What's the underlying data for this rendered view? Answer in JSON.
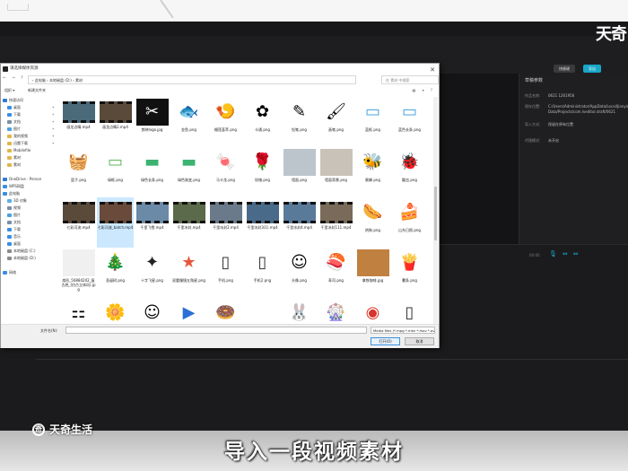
{
  "editor": {
    "brand_top": "天奇",
    "btn_shortcut": "快捷键",
    "btn_export": "导出",
    "panel_title": "草稿参数",
    "props": [
      {
        "k": "作品名称:",
        "v": "0621 1261956"
      },
      {
        "k": "保存位置:",
        "v": "C:/Users/Administrator/AppData/Local/JianyingPro/User Data/Projects/com.lveditor.draft/0621"
      },
      {
        "k": "导入方式:",
        "v": "保留在原有位置"
      },
      {
        "k": "color_space",
        "v": ""
      },
      {
        "k": "代理模式:",
        "v": "未开启"
      }
    ],
    "ruler": "00:00"
  },
  "dialog": {
    "title": "请选择媒体资源",
    "close": "✕",
    "nav_arrows": "← → ↑",
    "path": "› 此电脑 › 本地磁盘 (D:) › 素材",
    "search_placeholder": "在 素材 中搜索",
    "organize": "组织 ▾",
    "new_folder": "新建文件夹",
    "view_icons": "▦ ▾ ?",
    "nav_items": [
      {
        "label": "快速访问",
        "color": "#2e7bd6",
        "indent": false,
        "pin": false
      },
      {
        "label": "桌面",
        "color": "#3a8ee6",
        "indent": true,
        "pin": true
      },
      {
        "label": "下载",
        "color": "#3a8ee6",
        "indent": true,
        "pin": true
      },
      {
        "label": "文档",
        "color": "#7a8ea6",
        "indent": true,
        "pin": true
      },
      {
        "label": "图片",
        "color": "#4aa3df",
        "indent": true,
        "pin": true
      },
      {
        "label": "我的视频",
        "color": "#e0b64a",
        "indent": true,
        "pin": true
      },
      {
        "label": "迅雷下载",
        "color": "#e0b64a",
        "indent": true,
        "pin": true
      },
      {
        "label": "Mobilefile",
        "color": "#e0b64a",
        "indent": true,
        "pin": false
      },
      {
        "label": "素材",
        "color": "#e0b64a",
        "indent": true,
        "pin": false
      },
      {
        "label": "素材",
        "color": "#e0b64a",
        "indent": true,
        "pin": false
      },
      {
        "label": "",
        "color": "transparent",
        "indent": false,
        "pin": false
      },
      {
        "label": "OneDrive - Person",
        "color": "#2e7bd6",
        "indent": false,
        "pin": false
      },
      {
        "label": "WPS网盘",
        "color": "#3a8ee6",
        "indent": false,
        "pin": false
      },
      {
        "label": "此电脑",
        "color": "#3a8ee6",
        "indent": false,
        "pin": false
      },
      {
        "label": "3D 对象",
        "color": "#5ab0e6",
        "indent": true,
        "pin": false
      },
      {
        "label": "视频",
        "color": "#7a8ea6",
        "indent": true,
        "pin": false
      },
      {
        "label": "图片",
        "color": "#4aa3df",
        "indent": true,
        "pin": false
      },
      {
        "label": "文档",
        "color": "#7a8ea6",
        "indent": true,
        "pin": false
      },
      {
        "label": "下载",
        "color": "#3a8ee6",
        "indent": true,
        "pin": false
      },
      {
        "label": "音乐",
        "color": "#3a8ee6",
        "indent": true,
        "pin": false
      },
      {
        "label": "桌面",
        "color": "#3a8ee6",
        "indent": true,
        "pin": false
      },
      {
        "label": "本地磁盘 (C:)",
        "color": "#8a8a8a",
        "indent": true,
        "pin": false
      },
      {
        "label": "本地磁盘 (D:)",
        "color": "#8a8a8a",
        "indent": true,
        "pin": false
      },
      {
        "label": "",
        "color": "transparent",
        "indent": false,
        "pin": false
      },
      {
        "label": "网络",
        "color": "#3a8ee6",
        "indent": false,
        "pin": false
      }
    ],
    "files": [
      {
        "name": "画龙点睛.mp4",
        "kind": "video",
        "bg": "#4a6a7a",
        "glyph": ""
      },
      {
        "name": "画龙点睛2.mp4",
        "kind": "video",
        "bg": "#5a4a3a",
        "glyph": ""
      },
      {
        "name": "剪映logo.jpg",
        "kind": "img",
        "bg": "#111111",
        "glyph": "✂"
      },
      {
        "name": "金鱼.png",
        "kind": "img",
        "bg": "#ffffff",
        "glyph": "🐟"
      },
      {
        "name": "榴莲荟萃.png",
        "kind": "img",
        "bg": "#ffffff",
        "glyph": "🍤"
      },
      {
        "name": "卡通.png",
        "kind": "img",
        "bg": "#ffffff",
        "glyph": "✿"
      },
      {
        "name": "铅笔.png",
        "kind": "img",
        "bg": "#ffffff",
        "glyph": "✎"
      },
      {
        "name": "画笔.png",
        "kind": "img",
        "bg": "#ffffff",
        "glyph": "🖌"
      },
      {
        "name": "蓝框.png",
        "kind": "img",
        "bg": "#ffffff",
        "glyph": "▭"
      },
      {
        "name": "蓝色长条.png",
        "kind": "img",
        "bg": "#ffffff",
        "glyph": "▭"
      },
      {
        "name": "篮子.png",
        "kind": "img",
        "bg": "#ffffff",
        "glyph": "🧺"
      },
      {
        "name": "绿框.png",
        "kind": "img",
        "bg": "#ffffff",
        "glyph": "▭"
      },
      {
        "name": "绿色长条.png",
        "kind": "img",
        "bg": "#ffffff",
        "glyph": "▬"
      },
      {
        "name": "绿色渐变.png",
        "kind": "img",
        "bg": "#ffffff",
        "glyph": "▬"
      },
      {
        "name": "马卡龙.png",
        "kind": "img",
        "bg": "#ffffff",
        "glyph": "🍬"
      },
      {
        "name": "玫瑰.png",
        "kind": "img",
        "bg": "#ffffff",
        "glyph": "🌹"
      },
      {
        "name": "墙面.png",
        "kind": "img",
        "bg": "#bcc4cc",
        "glyph": ""
      },
      {
        "name": "墙面背景.png",
        "kind": "img",
        "bg": "#c9c2b8",
        "glyph": ""
      },
      {
        "name": "蜜蜂.png",
        "kind": "img",
        "bg": "#ffffff",
        "glyph": "🐝"
      },
      {
        "name": "瓢虫.png",
        "kind": "img",
        "bg": "#ffffff",
        "glyph": "🐞"
      },
      {
        "name": "七彩河流.mp4",
        "kind": "video",
        "bg": "#5a4a3a",
        "glyph": ""
      },
      {
        "name": "七彩河流_batch.mp4",
        "kind": "video",
        "bg": "#6a4a3a",
        "glyph": "",
        "selected": true
      },
      {
        "name": "千里飞雪.mp4",
        "kind": "video",
        "bg": "#6a8aa8",
        "glyph": ""
      },
      {
        "name": "千里冰封.mp4",
        "kind": "video",
        "bg": "#5a6a4a",
        "glyph": ""
      },
      {
        "name": "千里冰封2.mp4",
        "kind": "video",
        "bg": "#6a7a8a",
        "glyph": ""
      },
      {
        "name": "千里冰封3(1).mp4",
        "kind": "video",
        "bg": "#4a6a8a",
        "glyph": ""
      },
      {
        "name": "千里冰封4.mp4",
        "kind": "video",
        "bg": "#5a7a9a",
        "glyph": ""
      },
      {
        "name": "千里冰封111.mp4",
        "kind": "video",
        "bg": "#7a6a5a",
        "glyph": ""
      },
      {
        "name": "热狗.png",
        "kind": "img",
        "bg": "#ffffff",
        "glyph": "🌭"
      },
      {
        "name": "山东日照.png",
        "kind": "img",
        "bg": "#ffffff",
        "glyph": "🍰"
      },
      {
        "name": "扇形_50884202_复古底_(仿古立体风).jpg",
        "kind": "img",
        "bg": "#f0f0f0",
        "glyph": ""
      },
      {
        "name": "圣诞树.png",
        "kind": "img",
        "bg": "#ffffff",
        "glyph": "🎄"
      },
      {
        "name": "十字飞星.png",
        "kind": "img",
        "bg": "#ffffff",
        "glyph": "✦"
      },
      {
        "name": "双重慢镜五角星.png",
        "kind": "img",
        "bg": "#ffffff",
        "glyph": "★"
      },
      {
        "name": "手机.png",
        "kind": "img",
        "bg": "#ffffff",
        "glyph": "▯"
      },
      {
        "name": "手机2.png",
        "kind": "img",
        "bg": "#ffffff",
        "glyph": "▯"
      },
      {
        "name": "头像.png",
        "kind": "img",
        "bg": "#ffffff",
        "glyph": "☺"
      },
      {
        "name": "寿司.png",
        "kind": "img",
        "bg": "#ffffff",
        "glyph": "🍣"
      },
      {
        "name": "拿铁咖啡.jpg",
        "kind": "img",
        "bg": "#c08040",
        "glyph": ""
      },
      {
        "name": "薯条.png",
        "kind": "img",
        "bg": "#ffffff",
        "glyph": "🍟"
      },
      {
        "name": "四角者追.png",
        "kind": "img",
        "bg": "#ffffff",
        "glyph": "⚏"
      },
      {
        "name": "太阳花.png",
        "kind": "img",
        "bg": "#ffffff",
        "glyph": "🌼"
      },
      {
        "name": "头头发.png",
        "kind": "img",
        "bg": "#ffffff",
        "glyph": "☺"
      },
      {
        "name": "天使海报0621.m4v",
        "kind": "img",
        "bg": "#ffffff",
        "glyph": "▶"
      },
      {
        "name": "甜甜圈.png",
        "kind": "img",
        "bg": "#ffffff",
        "glyph": "🍩"
      },
      {
        "name": "微信图片.png",
        "kind": "img",
        "bg": "#ffffff",
        "glyph": ""
      },
      {
        "name": "兔子.png",
        "kind": "img",
        "bg": "#ffffff",
        "glyph": "🐰"
      },
      {
        "name": "陀螺.png",
        "kind": "img",
        "bg": "#ffffff",
        "glyph": "🎡"
      },
      {
        "name": "微博.png",
        "kind": "img",
        "bg": "#ffffff",
        "glyph": "◉"
      },
      {
        "name": "小米手机.png",
        "kind": "img",
        "bg": "#ffffff",
        "glyph": "▯"
      }
    ],
    "filename_label": "文件名(N):",
    "filename_value": "",
    "filetype": "Media files (*.mpg *.mkv *.mov *.avi)",
    "open_btn": "打开(O)",
    "cancel_btn": "取消"
  },
  "overlay": {
    "watermark": "天奇生活",
    "subtitle": "导入一段视频素材"
  }
}
